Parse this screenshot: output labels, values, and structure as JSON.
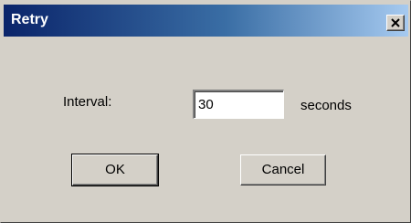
{
  "window": {
    "title": "Retry"
  },
  "form": {
    "interval_label": "Interval:",
    "interval_value": "30",
    "unit_label": "seconds"
  },
  "buttons": {
    "ok_label": "OK",
    "cancel_label": "Cancel"
  },
  "icons": {
    "close": "close-icon"
  },
  "colors": {
    "titlebar_start": "#0a246a",
    "titlebar_end": "#a6caf0",
    "face": "#d4d0c8"
  }
}
